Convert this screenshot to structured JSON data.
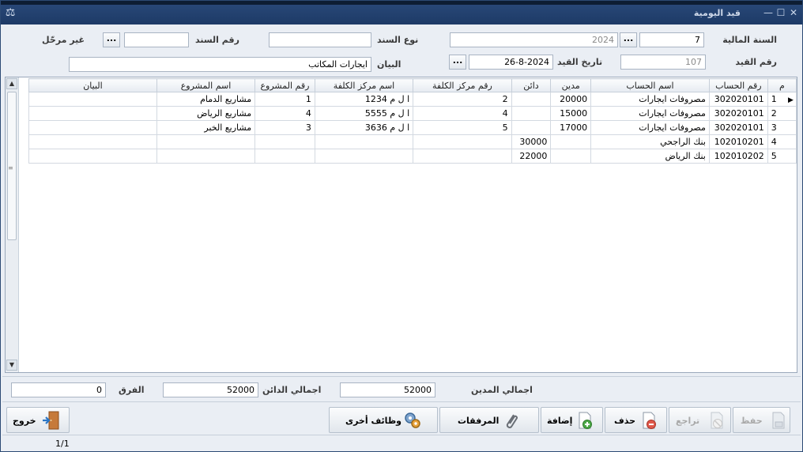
{
  "window": {
    "title": "قيد اليومية"
  },
  "header": {
    "fiscal_year_label": "السنة المالية",
    "fiscal_year_value": "7",
    "fiscal_year_year": "2024",
    "voucher_type_label": "نوع السند",
    "voucher_type_value": "",
    "voucher_no_label": "رقم السند",
    "voucher_no_value": "",
    "unposted_label": "غير مرحّل",
    "entry_no_label": "رقم القيد",
    "entry_no_value": "107",
    "entry_date_label": "تاريخ القيد",
    "entry_date_value": "26-8-2024",
    "description_label": "البيان",
    "description_value": "ايجارات المكاتب",
    "dots_label": "..."
  },
  "grid": {
    "columns": [
      "م",
      "رقم الحساب",
      "اسم الحساب",
      "مدين",
      "دائن",
      "رقم مركز الكلفة",
      "اسم مركز الكلفة",
      "رقم المشروع",
      "اسم المشروع",
      "البيان"
    ],
    "rows": [
      [
        "1",
        "302020101",
        "مصروفات ايجارات",
        "20000",
        "",
        "2",
        "ا ل م 1234",
        "1",
        "مشاريع الدمام",
        ""
      ],
      [
        "2",
        "302020101",
        "مصروفات ايجارات",
        "15000",
        "",
        "4",
        "ا ل م 5555",
        "4",
        "مشاريع الرياض",
        ""
      ],
      [
        "3",
        "302020101",
        "مصروفات ايجارات",
        "17000",
        "",
        "5",
        "ا ل م 3636",
        "3",
        "مشاريع الخبر",
        ""
      ],
      [
        "4",
        "102010201",
        "بنك الراجحي",
        "",
        "30000",
        "",
        "",
        "",
        "",
        ""
      ],
      [
        "5",
        "102010202",
        "بنك الرياض",
        "",
        "22000",
        "",
        "",
        "",
        "",
        ""
      ]
    ],
    "current_row_indicator": "▶"
  },
  "totals": {
    "debit_label": "اجمالي المدين",
    "debit_value": "52000",
    "credit_label": "اجمالي الدائن",
    "credit_value": "52000",
    "diff_label": "الفرق",
    "diff_value": "0"
  },
  "toolbar": {
    "save": "حفظ",
    "undo": "تراجع",
    "delete": "حذف",
    "add": "إضافة",
    "attachments": "المرفقات",
    "other_functions": "وظائف أخرى",
    "exit": "خروج"
  },
  "status": {
    "record_position": "1/1"
  }
}
